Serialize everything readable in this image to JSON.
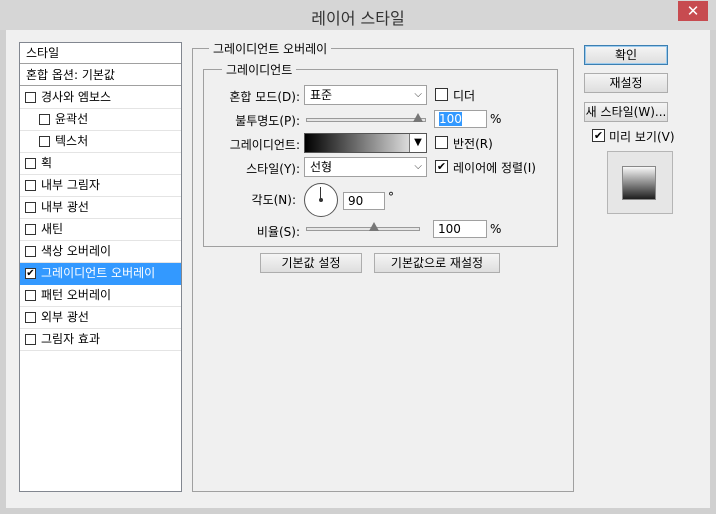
{
  "window": {
    "title": "레이어 스타일",
    "close_glyph": "✕"
  },
  "style_list": {
    "header": "스타일",
    "blend_options": "혼합 옵션: 기본값",
    "items": [
      {
        "label": "경사와 엠보스",
        "checked": false,
        "sub": false
      },
      {
        "label": "윤곽선",
        "checked": false,
        "sub": true
      },
      {
        "label": "텍스처",
        "checked": false,
        "sub": true
      },
      {
        "label": "획",
        "checked": false,
        "sub": false
      },
      {
        "label": "내부 그림자",
        "checked": false,
        "sub": false
      },
      {
        "label": "내부 광선",
        "checked": false,
        "sub": false
      },
      {
        "label": "새틴",
        "checked": false,
        "sub": false
      },
      {
        "label": "색상 오버레이",
        "checked": false,
        "sub": false
      },
      {
        "label": "그레이디언트 오버레이",
        "checked": true,
        "sub": false,
        "selected": true
      },
      {
        "label": "패턴 오버레이",
        "checked": false,
        "sub": false
      },
      {
        "label": "외부 광선",
        "checked": false,
        "sub": false
      },
      {
        "label": "그림자 효과",
        "checked": false,
        "sub": false
      }
    ]
  },
  "panel": {
    "outer_title": "그레이디언트 오버레이",
    "inner_title": "그레이디언트",
    "blend_mode_label": "혼합 모드(D):",
    "blend_mode_value": "표준",
    "dither_label": "디더",
    "opacity_label": "불투명도(P):",
    "opacity_value": "100",
    "opacity_unit": "%",
    "gradient_label": "그레이디언트:",
    "reverse_label": "반전(R)",
    "style_label": "스타일(Y):",
    "style_value": "선형",
    "align_label": "레이어에 정렬(I)",
    "angle_label": "각도(N):",
    "angle_value": "90",
    "angle_unit": "°",
    "scale_label": "비율(S):",
    "scale_value": "100",
    "scale_unit": "%",
    "make_default": "기본값 설정",
    "reset_default": "기본값으로 재설정"
  },
  "right": {
    "ok": "확인",
    "reset": "재설정",
    "new_style": "새 스타일(W)...",
    "preview_label": "미리 보기(V)"
  },
  "check_glyph": "✔",
  "dropdown_glyph": "▼"
}
